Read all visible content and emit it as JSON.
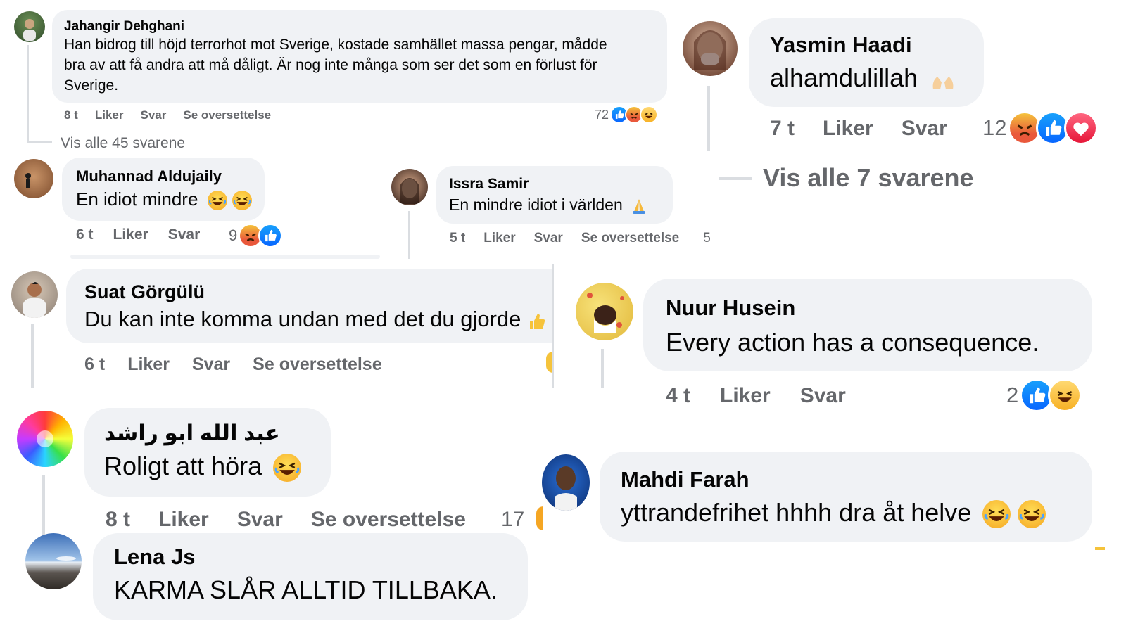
{
  "comments": [
    {
      "name": "Jahangir Dehghani",
      "lines": [
        "Han bidrog till höjd terrorhot mot Sverige, kostade samhället massa pengar, mådde",
        "bra av att få andra att må dåligt. Är nog inte många som ser det som en förlust för",
        "Sverige."
      ],
      "time": "8 t",
      "like": "Liker",
      "reply": "Svar",
      "translate": "Se oversettelse",
      "reactions_count": "72",
      "view_replies": "Vis alle 45 svarene"
    },
    {
      "name": "Yasmin Haadi",
      "text": "alhamdulillah",
      "time": "7 t",
      "like": "Liker",
      "reply": "Svar",
      "reactions_count": "12",
      "view_replies": "Vis alle 7 svarene"
    },
    {
      "name": "Muhannad Aldujaily",
      "text": "En idiot mindre",
      "time": "6 t",
      "like": "Liker",
      "reply": "Svar",
      "reactions_count": "9"
    },
    {
      "name": "Issra Samir",
      "text": "En mindre idiot i världen",
      "time": "5 t",
      "like": "Liker",
      "reply": "Svar",
      "translate": "Se oversettelse",
      "reactions_count": "5"
    },
    {
      "name": "Suat Görgülü",
      "text": "Du kan inte komma undan med det du gjorde",
      "time": "6 t",
      "like": "Liker",
      "reply": "Svar",
      "translate": "Se oversettelse"
    },
    {
      "name": "Nuur Husein",
      "text": "Every action has a consequence.",
      "time": "4 t",
      "like": "Liker",
      "reply": "Svar",
      "reactions_count": "2"
    },
    {
      "name": "عبد الله ابو راشد",
      "text": "Roligt att höra",
      "time": "8 t",
      "like": "Liker",
      "reply": "Svar",
      "translate": "Se oversettelse",
      "reactions_count": "17"
    },
    {
      "name": "Mahdi Farah",
      "text": "yttrandefrihet hhhh dra åt helve"
    },
    {
      "name": "Lena Js",
      "text": "KARMA SLÅR ALLTID TILLBAKA."
    }
  ],
  "colors": {
    "bubble": "#f0f2f5",
    "meta": "#65676b",
    "like_blue": "#0866ff",
    "text": "#050505"
  }
}
